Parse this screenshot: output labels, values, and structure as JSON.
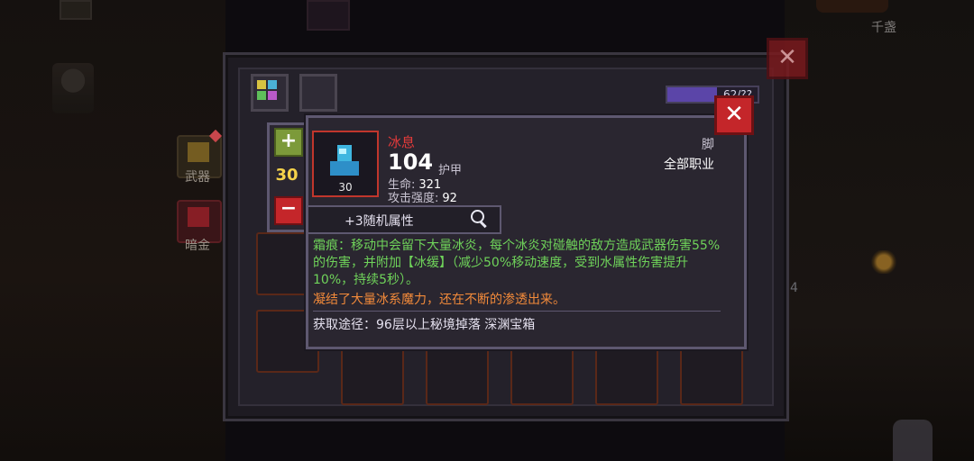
{
  "background": {
    "side_tabs": [
      {
        "label": "武器",
        "icon": "sword-box-icon"
      },
      {
        "label": "暗金",
        "icon": "red-chest-icon"
      }
    ],
    "top_right_label": "千盏",
    "right_number": "4"
  },
  "inventory": {
    "capacity_text": "62/??",
    "capacity_fraction": 0.55,
    "category_icons": [
      "palette-icon",
      "armor-icon"
    ]
  },
  "tooltip": {
    "item_name": "冰息",
    "armor_value": "104",
    "armor_label": "护甲",
    "stats": [
      {
        "label": "生命:",
        "value": "321"
      },
      {
        "label": "攻击强度:",
        "value": "92"
      }
    ],
    "slot_type": "脚",
    "class_requirement": "全部职业",
    "item_level": "30",
    "upgrade_level": "30",
    "random_attributes": "+3随机属性",
    "effect_text": "霜痕：移动中会留下大量冰炎，每个冰炎对碰触的敌方造成武器伤害55%的伤害，并附加【冰缓】（减少50%移动速度，受到水属性伤害提升10%，持续5秒）。",
    "flavor_text": "凝结了大量冰系魔力，还在不断的渗透出来。",
    "source_text": "获取途径：96层以上秘境掉落 深渊宝箱",
    "colors": {
      "name": "#e23a3a",
      "effect": "#6fd35a",
      "flavor": "#f28a3a",
      "level": "#f5d24a"
    }
  }
}
